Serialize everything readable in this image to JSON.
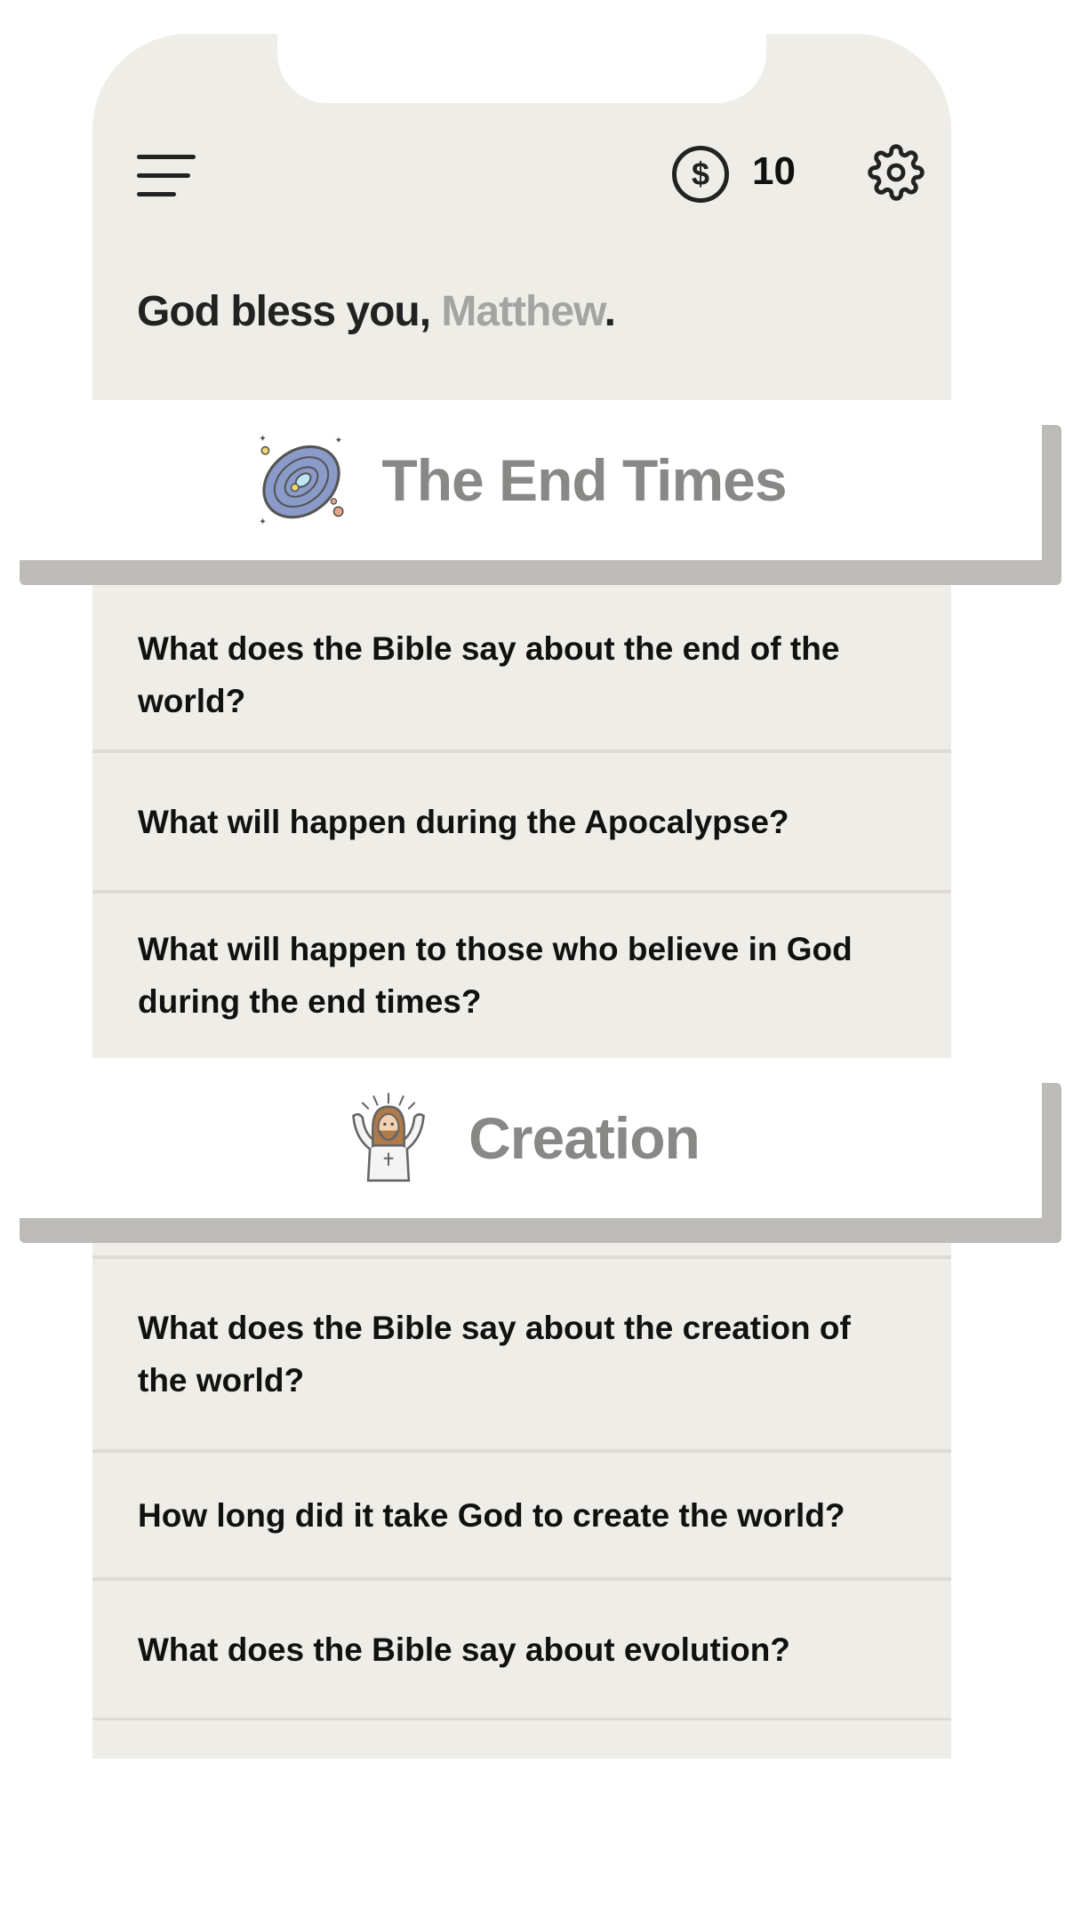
{
  "header": {
    "menu_icon": "hamburger-menu-icon",
    "coin_icon": "dollar-coin-icon",
    "coin_symbol": "$",
    "coin_count": "10",
    "settings_icon": "gear-icon"
  },
  "greeting": {
    "prefix": "God bless you, ",
    "name": "Matthew",
    "suffix": "."
  },
  "sections": [
    {
      "title": "The End Times",
      "icon": "galaxy-icon",
      "questions": [
        "What does the Bible say about the end of the world?",
        "What will happen during the Apocalypse?",
        "What will happen to those who believe in God during the end times?"
      ]
    },
    {
      "title": "Creation",
      "icon": "jesus-icon",
      "questions": [
        "What does the Bible say about the creation of the world?",
        "How long did it take God to create the world?",
        "What does the Bible say about evolution?"
      ]
    }
  ],
  "colors": {
    "background": "#efede7",
    "card": "#ffffff",
    "card_title": "#888886",
    "name_accent": "#a4a4a0",
    "text": "#111111"
  }
}
